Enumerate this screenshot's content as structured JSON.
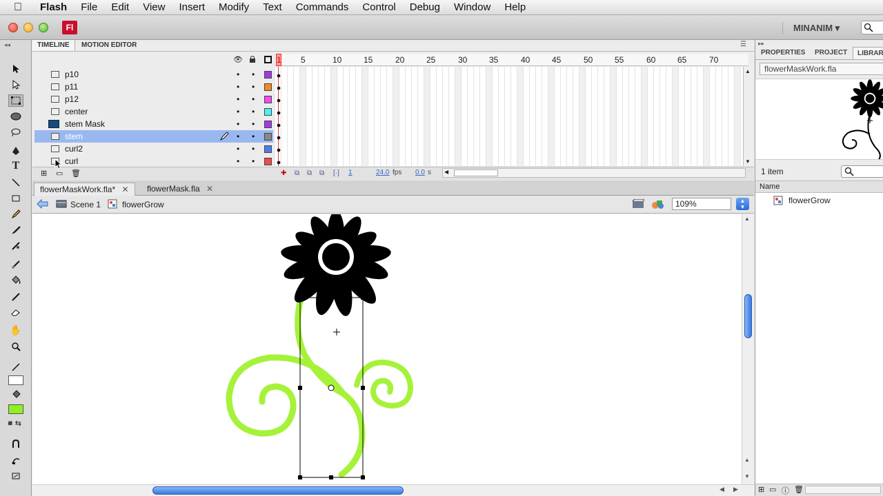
{
  "menubar": {
    "app": "Flash",
    "items": [
      "File",
      "Edit",
      "View",
      "Insert",
      "Modify",
      "Text",
      "Commands",
      "Control",
      "Debug",
      "Window",
      "Help"
    ]
  },
  "titlebar": {
    "logo": "Fl",
    "workspace": "MINANIM ▾"
  },
  "timeline": {
    "tabs": [
      "TIMELINE",
      "MOTION EDITOR"
    ],
    "frame_numbers": [
      "1",
      "5",
      "10",
      "15",
      "20",
      "25",
      "30",
      "35",
      "40",
      "45",
      "50",
      "55",
      "60",
      "65",
      "70"
    ],
    "layers": [
      {
        "name": "p10",
        "color": "#a23ae8",
        "selected": false
      },
      {
        "name": "p11",
        "color": "#f28a1c",
        "selected": false
      },
      {
        "name": "p12",
        "color": "#f04cf0",
        "selected": false
      },
      {
        "name": "center",
        "color": "#4cf0f0",
        "selected": false
      },
      {
        "name": "stem Mask",
        "color": "#a23ae8",
        "selected": false
      },
      {
        "name": "stem",
        "color": "#888888",
        "selected": true
      },
      {
        "name": "curl2",
        "color": "#4c7cf0",
        "selected": false
      },
      {
        "name": "curl",
        "color": "#f04c4c",
        "selected": false
      }
    ],
    "status": {
      "frame": "1",
      "fps": "24.0",
      "fps_unit": "fps",
      "time": "0.0",
      "time_unit": "s"
    }
  },
  "doc_tabs": [
    {
      "label": "flowerMaskWork.fla*",
      "active": true
    },
    {
      "label": "flowerMask.fla",
      "active": false
    }
  ],
  "editbar": {
    "scene": "Scene 1",
    "symbol": "flowerGrow",
    "zoom": "109%"
  },
  "right_panel": {
    "tabs": [
      "PROPERTIES",
      "PROJECT",
      "LIBRAR"
    ],
    "library_file": "flowerMaskWork.fla",
    "item_count": "1 item",
    "column_name": "Name",
    "items": [
      "flowerGrow"
    ]
  },
  "colors": {
    "stem_green": "#a6f23a",
    "flower": "#000000",
    "selection": "#9ab8f0"
  }
}
